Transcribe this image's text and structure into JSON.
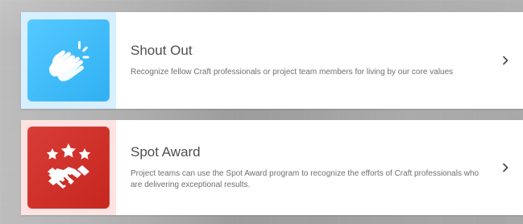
{
  "cards": [
    {
      "title": "Shout Out",
      "description": "Recognize fellow Craft professionals or project team members for living by our core values",
      "icon": "clapping-hands-icon"
    },
    {
      "title": "Spot Award",
      "description": "Project teams can use the Spot Award program to recognize the efforts of Craft professionals who are delivering exceptional results.",
      "icon": "stars-handshake-icon"
    }
  ],
  "navigation": {
    "chevron_icon": "chevron-right-icon"
  },
  "colors": {
    "shout_out_tile": "#3bb8f6",
    "spot_award_tile": "#d12f29",
    "shout_out_panel": "#d7efff",
    "spot_award_panel": "#fde3e2",
    "card_background": "#ffffff",
    "title_text": "#4f4f4f",
    "description_text": "#6f6f6f"
  }
}
